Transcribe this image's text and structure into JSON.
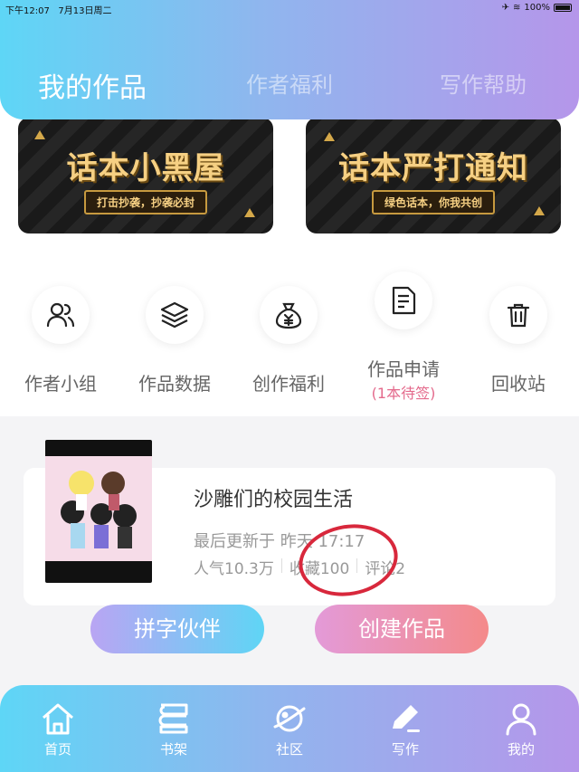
{
  "status": {
    "time": "下午12:07",
    "date": "7月13日周二",
    "battery": "100%"
  },
  "tabs": [
    {
      "label": "我的作品",
      "active": true
    },
    {
      "label": "作者福利",
      "active": false
    },
    {
      "label": "写作帮助",
      "active": false
    }
  ],
  "banners": [
    {
      "title": "话本小黑屋",
      "subtitle": "打击抄袭，抄袭必封"
    },
    {
      "title": "话本严打通知",
      "subtitle": "绿色话本，你我共创"
    }
  ],
  "quick_actions": [
    {
      "label": "作者小组",
      "icon": "group-icon"
    },
    {
      "label": "作品数据",
      "icon": "layers-icon"
    },
    {
      "label": "创作福利",
      "icon": "money-bag-icon"
    },
    {
      "label": "作品申请",
      "sub": "(1本待签)",
      "icon": "document-icon"
    },
    {
      "label": "回收站",
      "icon": "trash-icon"
    }
  ],
  "work": {
    "title": "沙雕们的校园生活",
    "updated": "最后更新于 昨天 17:17",
    "popularity": "人气10.3万",
    "favorites": "收藏100",
    "comments": "评论2"
  },
  "buttons": {
    "partner": "拼字伙伴",
    "create": "创建作品"
  },
  "nav": [
    {
      "label": "首页",
      "icon": "home-icon"
    },
    {
      "label": "书架",
      "icon": "bookshelf-icon"
    },
    {
      "label": "社区",
      "icon": "planet-icon"
    },
    {
      "label": "写作",
      "icon": "pen-icon"
    },
    {
      "label": "我的",
      "icon": "user-icon"
    }
  ],
  "colors": {
    "gradient_start": "#5ed6f6",
    "gradient_end": "#b596ea",
    "banner_gold": "#f6d083",
    "pending_pink": "#e46a8c",
    "annotation_red": "#d8283c"
  }
}
